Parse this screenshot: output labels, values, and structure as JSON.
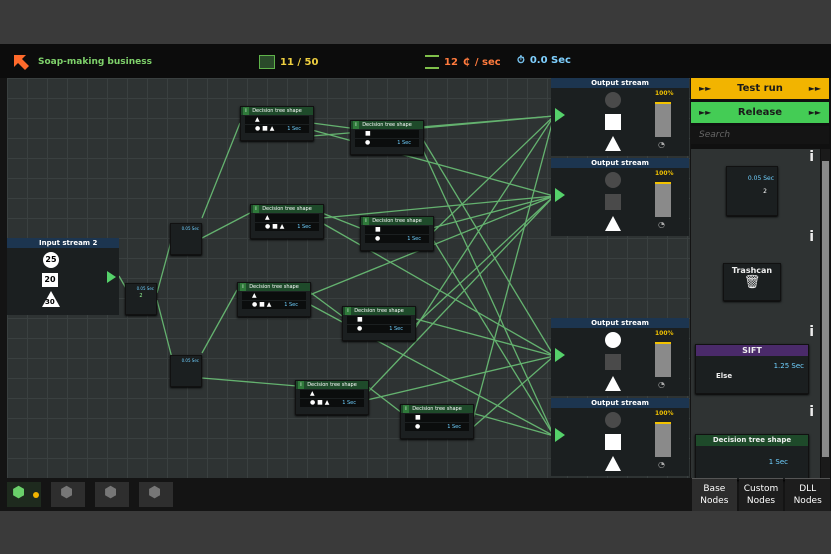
{
  "header": {
    "title": "Soap-making business",
    "progress": "11 / 50",
    "income": "12",
    "income_unit": "/ sec",
    "timer": "0.0 Sec"
  },
  "colors": {
    "accent": "#55d16a",
    "title": "#7fd26b",
    "income": "#ff7a3d",
    "timer": "#7fd0ff",
    "test_run": "#f2b400",
    "release": "#44cc55"
  },
  "input_stream": {
    "title": "Input stream 2",
    "items": [
      "25",
      "20",
      "30"
    ]
  },
  "decision_node": {
    "title": "Decision tree shape",
    "time": "1 Sec"
  },
  "splitter": {
    "time": "0.05 Sec",
    "count": "2"
  },
  "splitter_short": {
    "time": "0.05 Sec"
  },
  "output_streams": [
    {
      "title": "Output stream",
      "percent": "100%",
      "fill": 1.0
    },
    {
      "title": "Output stream",
      "percent": "100%",
      "fill": 1.0
    },
    {
      "title": "Output stream",
      "percent": "100%",
      "fill": 1.0
    },
    {
      "title": "Output stream",
      "percent": "100%",
      "fill": 1.0
    }
  ],
  "sidebar": {
    "test_run": "Test run",
    "release": "Release",
    "search_placeholder": "Search",
    "palette_splitter_time": "0.05 Sec",
    "palette_splitter_count": "2",
    "trashcan": "Trashcan",
    "sift": {
      "title": "SIFT",
      "time": "1.25 Sec",
      "else": "Else"
    },
    "decision": {
      "title": "Decision tree shape",
      "time": "1 Sec"
    },
    "info": "i"
  },
  "tabs": [
    "Base\nNodes",
    "Custom\nNodes",
    "DLL\nNodes"
  ]
}
